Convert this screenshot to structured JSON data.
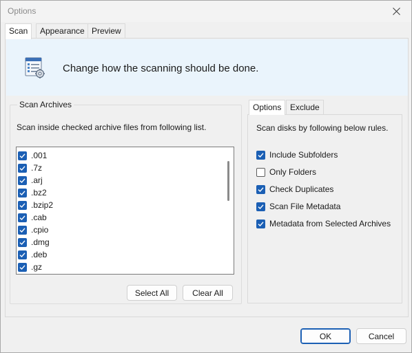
{
  "window": {
    "title": "Options"
  },
  "tabs": [
    "Scan",
    "Appearance",
    "Preview"
  ],
  "banner": {
    "text": "Change how the scanning should be done."
  },
  "scan_archives": {
    "label": "Scan Archives",
    "hint": "Scan inside checked archive files from following list.",
    "items": [
      {
        "label": ".001",
        "checked": true
      },
      {
        "label": ".7z",
        "checked": true
      },
      {
        "label": ".arj",
        "checked": true
      },
      {
        "label": ".bz2",
        "checked": true
      },
      {
        "label": ".bzip2",
        "checked": true
      },
      {
        "label": ".cab",
        "checked": true
      },
      {
        "label": ".cpio",
        "checked": true
      },
      {
        "label": ".dmg",
        "checked": true
      },
      {
        "label": ".deb",
        "checked": true
      },
      {
        "label": ".gz",
        "checked": true
      }
    ],
    "select_all": "Select All",
    "clear_all": "Clear All"
  },
  "inner_tabs": [
    "Options",
    "Exclude"
  ],
  "options": {
    "description": "Scan disks by following below rules.",
    "items": [
      {
        "label": "Include Subfolders",
        "checked": true
      },
      {
        "label": "Only Folders",
        "checked": false
      },
      {
        "label": "Check Duplicates",
        "checked": true
      },
      {
        "label": "Scan File Metadata",
        "checked": true
      },
      {
        "label": "Metadata from Selected Archives",
        "checked": true
      }
    ]
  },
  "footer": {
    "ok": "OK",
    "cancel": "Cancel"
  },
  "colors": {
    "accent": "#1b5fb4",
    "banner_bg": "#eaf4fc"
  },
  "icons": {
    "close": "close-icon",
    "banner": "settings-list-icon",
    "check": "checkmark-icon"
  }
}
